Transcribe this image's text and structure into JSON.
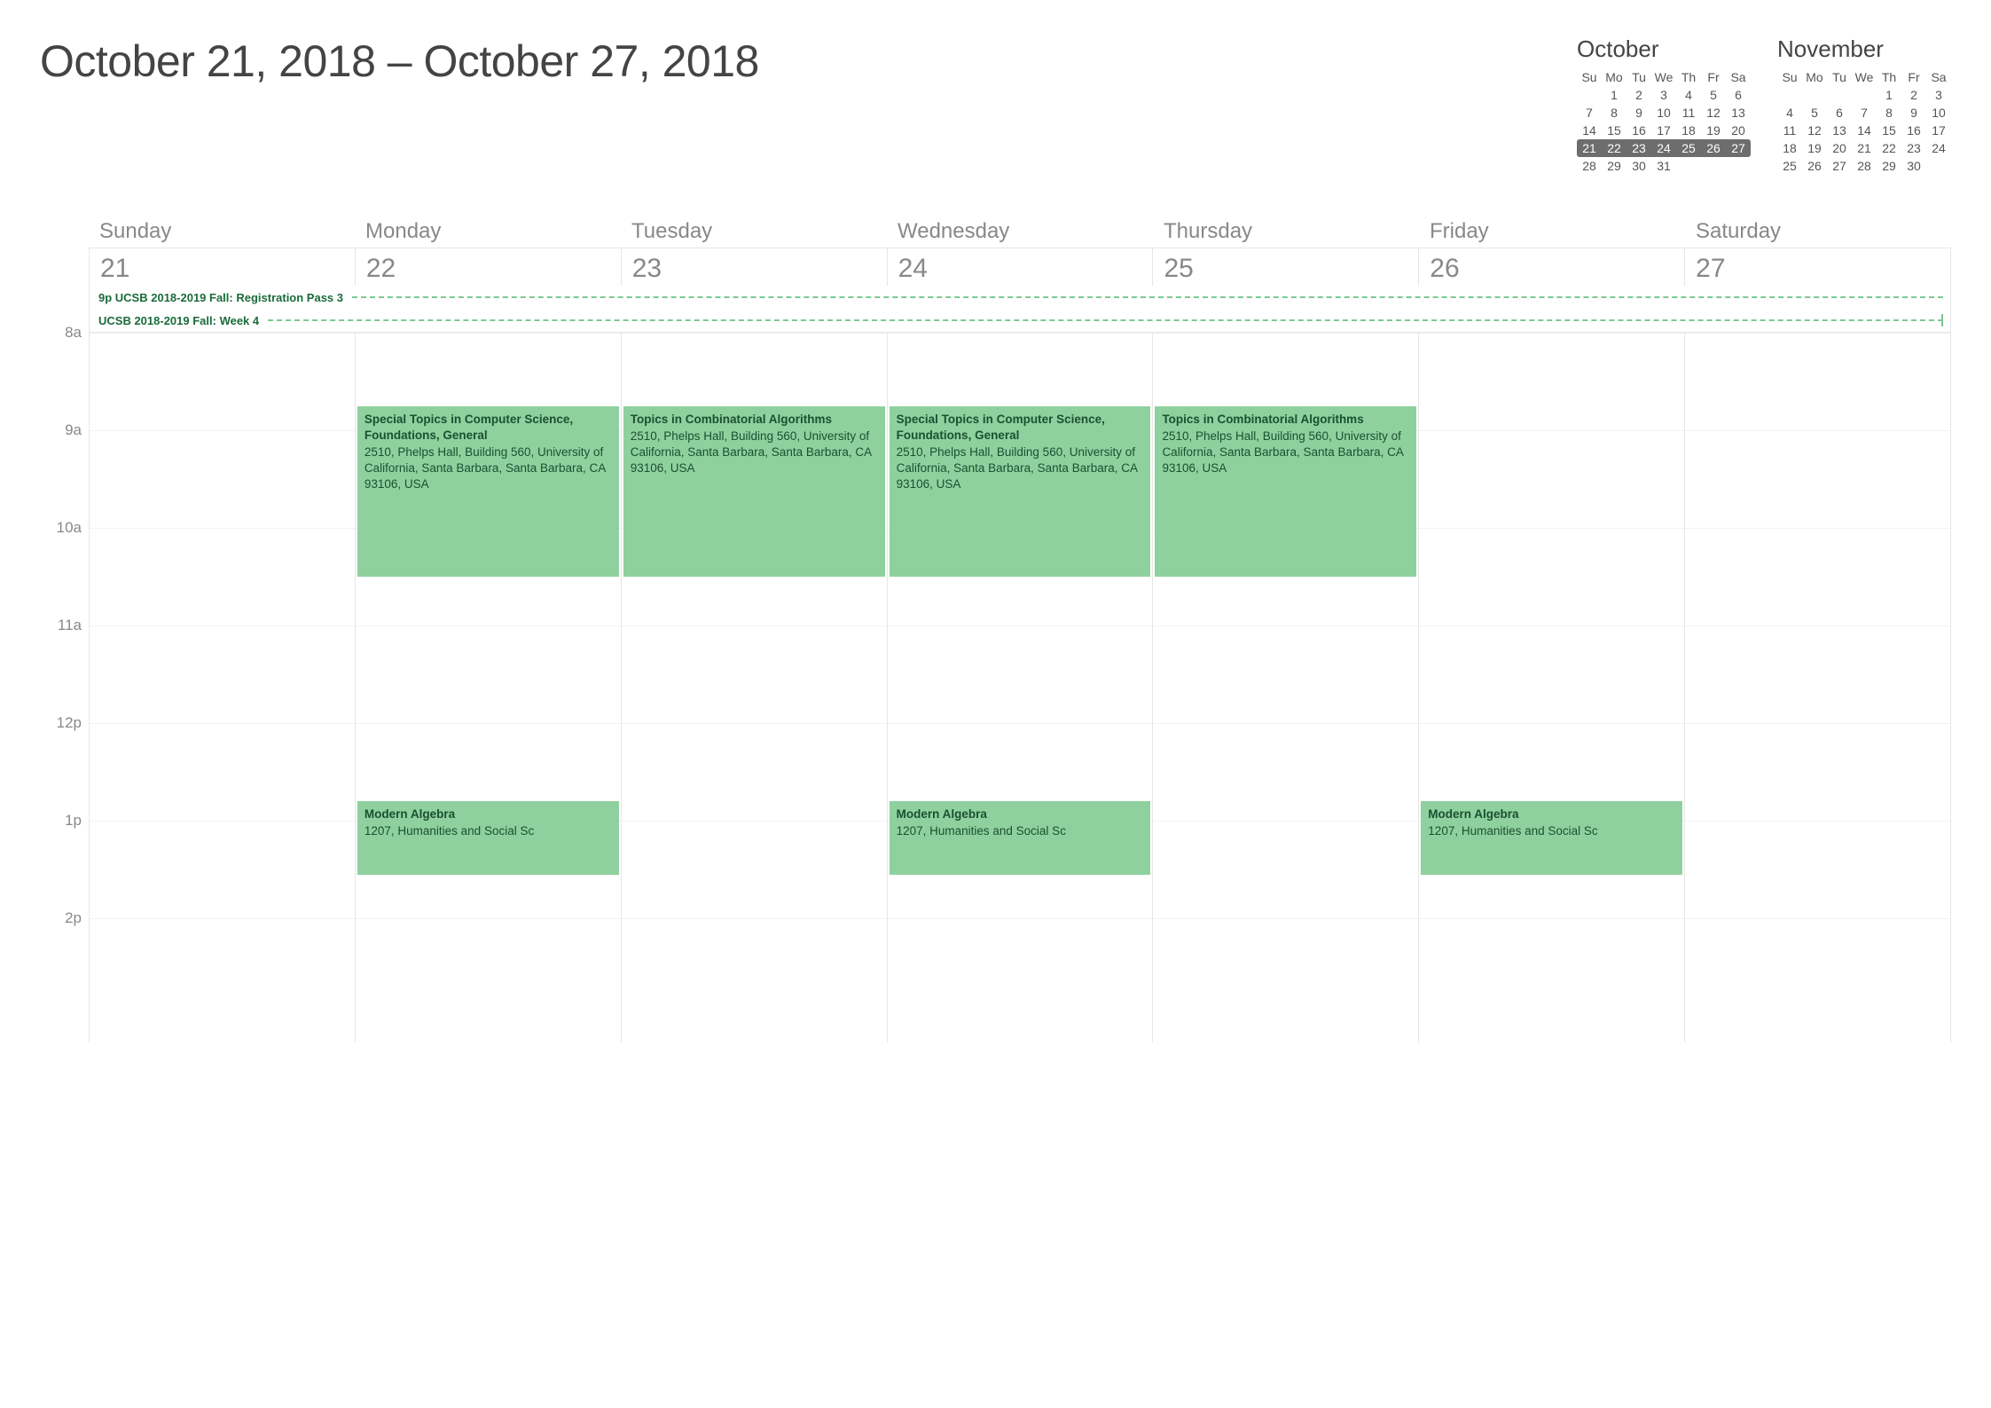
{
  "title": "October 21, 2018 – October 27, 2018",
  "miniCals": [
    {
      "name": "October",
      "dow": [
        "Su",
        "Mo",
        "Tu",
        "We",
        "Th",
        "Fr",
        "Sa"
      ],
      "rows": [
        [
          "",
          "1",
          "2",
          "3",
          "4",
          "5",
          "6"
        ],
        [
          "7",
          "8",
          "9",
          "10",
          "11",
          "12",
          "13"
        ],
        [
          "14",
          "15",
          "16",
          "17",
          "18",
          "19",
          "20"
        ],
        [
          "21",
          "22",
          "23",
          "24",
          "25",
          "26",
          "27"
        ],
        [
          "28",
          "29",
          "30",
          "31",
          "",
          "",
          ""
        ]
      ],
      "highlightRow": 3
    },
    {
      "name": "November",
      "dow": [
        "Su",
        "Mo",
        "Tu",
        "We",
        "Th",
        "Fr",
        "Sa"
      ],
      "rows": [
        [
          "",
          "",
          "",
          "",
          "1",
          "2",
          "3"
        ],
        [
          "4",
          "5",
          "6",
          "7",
          "8",
          "9",
          "10"
        ],
        [
          "11",
          "12",
          "13",
          "14",
          "15",
          "16",
          "17"
        ],
        [
          "18",
          "19",
          "20",
          "21",
          "22",
          "23",
          "24"
        ],
        [
          "25",
          "26",
          "27",
          "28",
          "29",
          "30",
          ""
        ]
      ],
      "highlightRow": -1
    }
  ],
  "days": [
    {
      "name": "Sunday",
      "num": "21"
    },
    {
      "name": "Monday",
      "num": "22"
    },
    {
      "name": "Tuesday",
      "num": "23"
    },
    {
      "name": "Wednesday",
      "num": "24"
    },
    {
      "name": "Thursday",
      "num": "25"
    },
    {
      "name": "Friday",
      "num": "26"
    },
    {
      "name": "Saturday",
      "num": "27"
    }
  ],
  "alldayEvents": [
    {
      "label": "9p UCSB 2018-2019 Fall: Registration Pass 3",
      "endBar": false
    },
    {
      "label": "UCSB 2018-2019 Fall: Week 4",
      "endBar": true
    }
  ],
  "hourStart": 8,
  "hourEnd": 14,
  "hourHeight": 110,
  "hourLabels": [
    "8a",
    "9a",
    "10a",
    "11a",
    "12p",
    "1p",
    "2p"
  ],
  "events": [
    {
      "day": 1,
      "startHour": 8.75,
      "endHour": 10.5,
      "title": "Special Topics in Computer Science, Foundations, General",
      "loc": "2510, Phelps Hall, Building 560, University of California, Santa Barbara, Santa Barbara, CA 93106, USA"
    },
    {
      "day": 2,
      "startHour": 8.75,
      "endHour": 10.5,
      "title": "Topics in Combinatorial Algorithms",
      "loc": "2510, Phelps Hall, Building 560, University of California, Santa Barbara, Santa Barbara, CA 93106, USA"
    },
    {
      "day": 3,
      "startHour": 8.75,
      "endHour": 10.5,
      "title": "Special Topics in Computer Science, Foundations, General",
      "loc": "2510, Phelps Hall, Building 560, University of California, Santa Barbara, Santa Barbara, CA 93106, USA"
    },
    {
      "day": 4,
      "startHour": 8.75,
      "endHour": 10.5,
      "title": "Topics in Combinatorial Algorithms",
      "loc": "2510, Phelps Hall, Building 560, University of California, Santa Barbara, Santa Barbara, CA 93106, USA"
    },
    {
      "day": 1,
      "startHour": 12.8,
      "endHour": 13.55,
      "title": "Modern Algebra",
      "loc": "1207, Humanities and Social Sc"
    },
    {
      "day": 3,
      "startHour": 12.8,
      "endHour": 13.55,
      "title": "Modern Algebra",
      "loc": "1207, Humanities and Social Sc"
    },
    {
      "day": 5,
      "startHour": 12.8,
      "endHour": 13.55,
      "title": "Modern Algebra",
      "loc": "1207, Humanities and Social Sc"
    }
  ]
}
